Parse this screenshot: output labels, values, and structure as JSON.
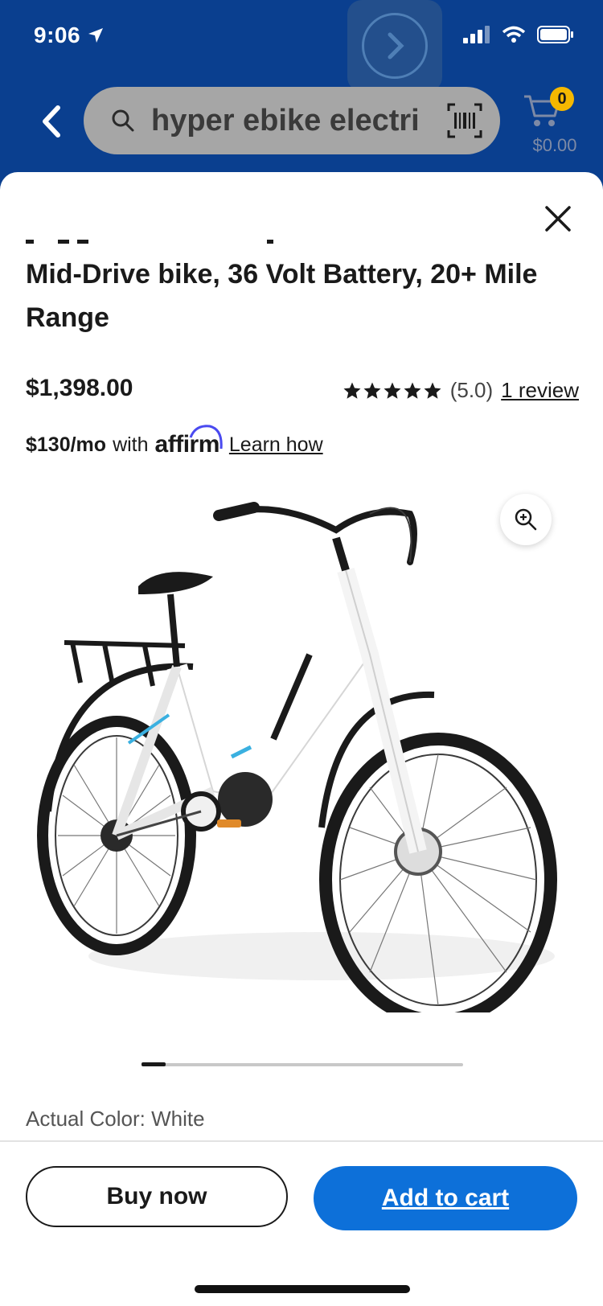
{
  "status_bar": {
    "time": "9:06"
  },
  "header": {
    "search_query": "hyper ebike electri",
    "cart_count": "0",
    "cart_total": "$0.00"
  },
  "product": {
    "title": "Mid-Drive bike, 36 Volt Battery, 20+ Mile Range",
    "price": "$1,398.00",
    "rating": "(5.0)",
    "reviews": "1 review",
    "affirm": {
      "monthly": "$130/mo",
      "with": "with",
      "brand": "affirm",
      "learn": "Learn how"
    },
    "color_label": "Actual Color: White"
  },
  "actions": {
    "buy_now": "Buy now",
    "add_to_cart": "Add to cart"
  },
  "colors": {
    "header_bg": "#0a3f8f",
    "cart_button": "#0d70d9",
    "badge": "#f5b800"
  },
  "icons": [
    "location-arrow-icon",
    "forward-icon",
    "back-chevron-icon",
    "search-icon",
    "barcode-icon",
    "cart-icon",
    "close-icon",
    "star-icon",
    "zoom-icon",
    "signal-icon",
    "wifi-icon",
    "battery-icon"
  ]
}
